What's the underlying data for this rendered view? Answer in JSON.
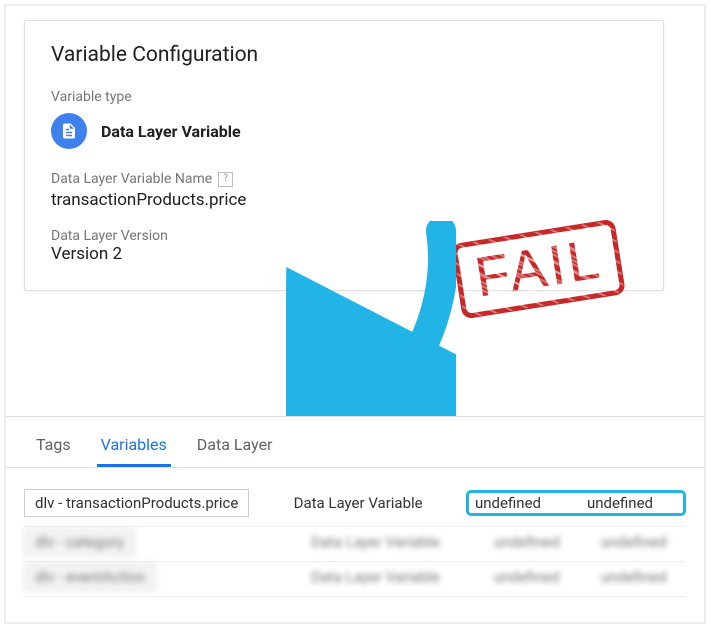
{
  "card": {
    "title": "Variable Configuration",
    "type_section_label": "Variable type",
    "type_name": "Data Layer Variable",
    "name_field": {
      "label": "Data Layer Variable Name",
      "help": "?",
      "value": "transactionProducts.price"
    },
    "version_field": {
      "label": "Data Layer Version",
      "value": "Version 2"
    }
  },
  "stamp": {
    "text": "FAIL"
  },
  "debug": {
    "tabs": [
      {
        "label": "Tags",
        "active": false
      },
      {
        "label": "Variables",
        "active": true
      },
      {
        "label": "Data Layer",
        "active": false
      }
    ],
    "rows": [
      {
        "name": "dlv - transactionProducts.price",
        "type": "Data Layer Variable",
        "val1": "undefined",
        "val2": "undefined",
        "highlighted": true,
        "blurred": false
      },
      {
        "name": "dlv - category",
        "type": "Data Layer Variable",
        "val1": "undefined",
        "val2": "undefined",
        "highlighted": false,
        "blurred": true
      },
      {
        "name": "dlv - eventAction",
        "type": "Data Layer Variable",
        "val1": "undefined",
        "val2": "undefined",
        "highlighted": false,
        "blurred": true
      }
    ]
  }
}
